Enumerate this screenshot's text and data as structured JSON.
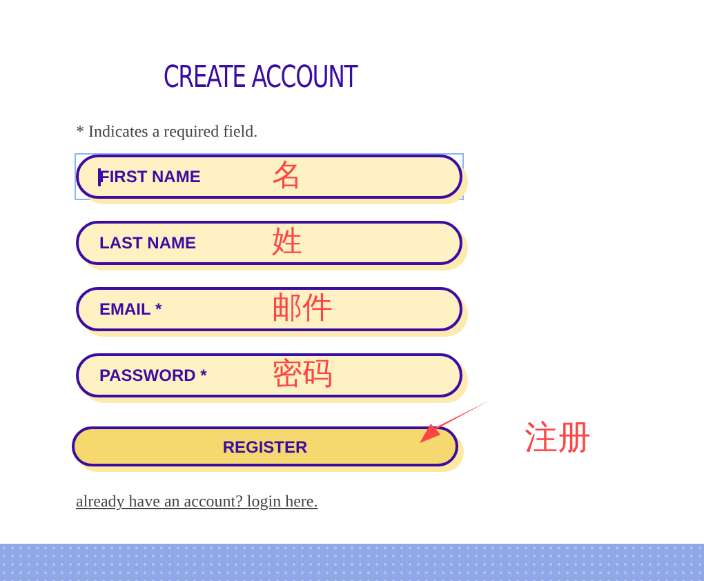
{
  "title": "CREATE ACCOUNT",
  "required_note": "* Indicates a required field.",
  "fields": [
    {
      "placeholder": "FIRST NAME",
      "focused": true,
      "annotation": "名"
    },
    {
      "placeholder": "LAST NAME",
      "focused": false,
      "annotation": "姓"
    },
    {
      "placeholder": "EMAIL *",
      "focused": false,
      "annotation": "邮件"
    },
    {
      "placeholder": "PASSWORD *",
      "focused": false,
      "annotation": "密码"
    }
  ],
  "register_button": {
    "label": "REGISTER",
    "annotation": "注册"
  },
  "login_link": "already have an account? login here."
}
